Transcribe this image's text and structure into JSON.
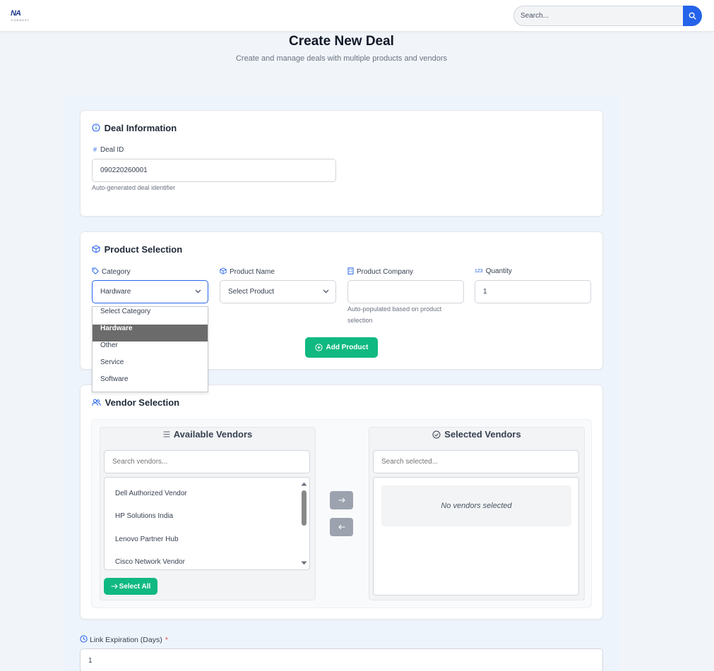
{
  "header": {
    "logo_text": "NA",
    "logo_subtext": "FORNEST",
    "search": {
      "placeholder": "Search..."
    }
  },
  "page": {
    "title": "Create New Deal",
    "subtitle": "Create and manage deals with multiple products and vendors"
  },
  "deal_info": {
    "title": "Deal Information",
    "deal_id_label": "Deal ID",
    "deal_id_value": "090220260001",
    "deal_id_hint": "Auto-generated deal identifier"
  },
  "product_selection": {
    "title": "Product Selection",
    "category_label": "Category",
    "category_value": "Hardware",
    "product_name_label": "Product Name",
    "product_name_value": "Select Product",
    "product_company_label": "Product Company",
    "product_company_value": "",
    "product_company_hint": "Auto-populated based on product selection",
    "quantity_label": "Quantity",
    "quantity_badge": "123",
    "quantity_value": "1",
    "add_product_label": "Add Product",
    "category_options": [
      "Select Category",
      "Hardware",
      "Other",
      "Service",
      "Software"
    ],
    "category_selected_index": 1
  },
  "vendor_selection": {
    "title": "Vendor Selection",
    "available_title": "Available Vendors",
    "available_search_placeholder": "Search vendors...",
    "available_vendors": [
      "Dell Authorized Vendor",
      "HP Solutions India",
      "Lenovo Partner Hub",
      "Cisco Network Vendor"
    ],
    "select_all_label": "Select All",
    "selected_title": "Selected Vendors",
    "selected_search_placeholder": "Search selected...",
    "no_vendors_text": "No vendors selected"
  },
  "link_expiration": {
    "label": "Link Expiration (Days)",
    "required_mark": "*",
    "value": "1"
  },
  "colors": {
    "primary": "#2563eb",
    "success": "#10b981",
    "required": "#ef4444",
    "dropdown_selected": "#6b6b6b"
  }
}
